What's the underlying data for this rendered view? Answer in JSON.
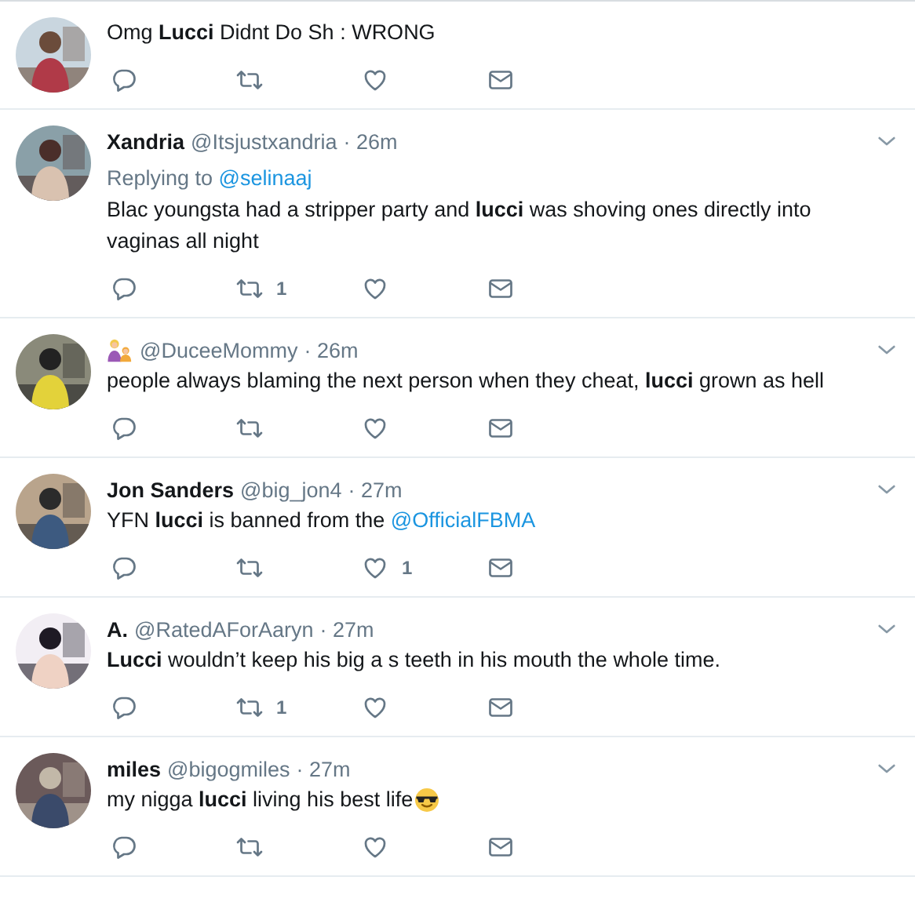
{
  "tweets": [
    {
      "body": [
        {
          "kind": "text",
          "text": "Omg **Lucci** Didnt Do Sh : WRONG"
        }
      ],
      "actions": [
        {
          "kind": "reply"
        },
        {
          "kind": "retweet"
        },
        {
          "kind": "like"
        },
        {
          "kind": "message"
        }
      ]
    },
    {
      "name": "Xandria",
      "handle": "@Itsjustxandria",
      "time": "· 26m",
      "replying_to": {
        "label": "Replying to",
        "mention": "@selinaaj"
      },
      "body": [
        {
          "kind": "text",
          "text": "Blac youngsta had a stripper party and **lucci** was shoving ones directly into vaginas all night"
        }
      ],
      "actions": [
        {
          "kind": "reply"
        },
        {
          "kind": "retweet",
          "count": "1"
        },
        {
          "kind": "like"
        },
        {
          "kind": "message"
        }
      ]
    },
    {
      "name_emoji": {
        "kind": "family"
      },
      "handle": "@DuceeMommy",
      "time": "· 26m",
      "body": [
        {
          "kind": "text",
          "text": "people always blaming the next person when they cheat, **lucci** grown as hell"
        }
      ],
      "actions": [
        {
          "kind": "reply"
        },
        {
          "kind": "retweet"
        },
        {
          "kind": "like"
        },
        {
          "kind": "message"
        }
      ]
    },
    {
      "name": "Jon Sanders",
      "handle": "@big_jon4",
      "time": "· 27m",
      "body": [
        {
          "kind": "text",
          "text": "YFN **lucci** is banned from the "
        },
        {
          "kind": "link",
          "text": "@OfficialFBMA"
        }
      ],
      "actions": [
        {
          "kind": "reply"
        },
        {
          "kind": "retweet"
        },
        {
          "kind": "like",
          "count": "1"
        },
        {
          "kind": "message"
        }
      ]
    },
    {
      "name": "A.",
      "handle": "@RatedAForAaryn",
      "time": "· 27m",
      "body": [
        {
          "kind": "text",
          "text": "**Lucci** wouldn’t keep his big a s teeth in his mouth the whole time."
        }
      ],
      "actions": [
        {
          "kind": "reply"
        },
        {
          "kind": "retweet",
          "count": "1"
        },
        {
          "kind": "like"
        },
        {
          "kind": "message"
        }
      ]
    },
    {
      "name": "miles",
      "handle": "@bigogmiles",
      "time": "· 27m",
      "body": [
        {
          "kind": "text",
          "text": "my nigga **lucci** living his best life"
        },
        {
          "kind": "sunglasses_emoji"
        }
      ],
      "actions": [
        {
          "kind": "reply"
        },
        {
          "kind": "retweet"
        },
        {
          "kind": "like"
        },
        {
          "kind": "message"
        }
      ]
    }
  ]
}
